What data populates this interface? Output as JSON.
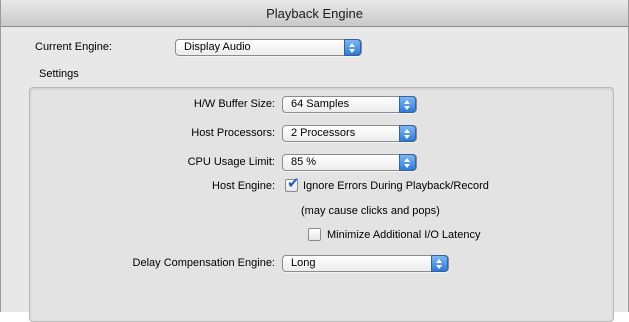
{
  "window": {
    "title": "Playback Engine"
  },
  "engine": {
    "label": "Current Engine:",
    "selected": "Display Audio"
  },
  "settings": {
    "group_label": "Settings",
    "hw_buffer": {
      "label": "H/W Buffer Size:",
      "selected": "64 Samples"
    },
    "host_processors": {
      "label": "Host Processors:",
      "selected": "2 Processors"
    },
    "cpu_usage": {
      "label": "CPU Usage Limit:",
      "selected": "85 %"
    },
    "host_engine": {
      "label": "Host Engine:",
      "ignore_errors": {
        "label": "Ignore Errors During Playback/Record",
        "checked": true
      },
      "note": "(may cause clicks and pops)",
      "minimize_latency": {
        "label": "Minimize Additional I/O Latency",
        "checked": false
      }
    },
    "delay_comp": {
      "label": "Delay Compensation Engine:",
      "selected": "Long"
    }
  },
  "icons": {
    "popup_arrows": "up-down-chevron-icon",
    "check": "checkmark-icon"
  },
  "colors": {
    "accent": "#2f7ad7",
    "window_bg": "#e8e8e8"
  }
}
